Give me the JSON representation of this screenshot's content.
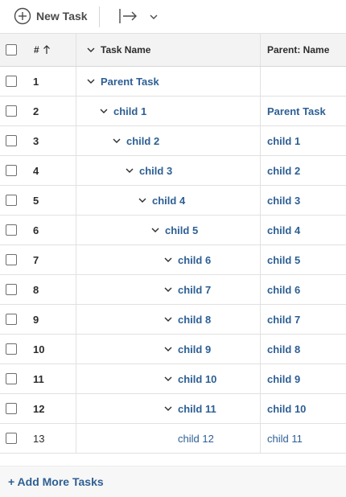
{
  "toolbar": {
    "new_task_label": "New Task",
    "icons": [
      "plus-circle-icon",
      "export-icon",
      "chevron-down-icon"
    ]
  },
  "columns": {
    "number": "#",
    "task_name": "Task Name",
    "parent_name": "Parent: Name"
  },
  "rows": [
    {
      "number": "1",
      "name": "Parent Task",
      "parent": "",
      "depth": 0,
      "collapsible": true
    },
    {
      "number": "2",
      "name": "child 1",
      "parent": "Parent Task",
      "depth": 1,
      "collapsible": true
    },
    {
      "number": "3",
      "name": "child 2",
      "parent": "child 1",
      "depth": 2,
      "collapsible": true
    },
    {
      "number": "4",
      "name": "child 3",
      "parent": "child 2",
      "depth": 3,
      "collapsible": true
    },
    {
      "number": "5",
      "name": "child 4",
      "parent": "child 3",
      "depth": 4,
      "collapsible": true
    },
    {
      "number": "6",
      "name": "child 5",
      "parent": "child 4",
      "depth": 5,
      "collapsible": true
    },
    {
      "number": "7",
      "name": "child 6",
      "parent": "child 5",
      "depth": 6,
      "collapsible": true
    },
    {
      "number": "8",
      "name": "child 7",
      "parent": "child 6",
      "depth": 6,
      "collapsible": true
    },
    {
      "number": "9",
      "name": "child 8",
      "parent": "child 7",
      "depth": 6,
      "collapsible": true
    },
    {
      "number": "10",
      "name": "child 9",
      "parent": "child 8",
      "depth": 6,
      "collapsible": true
    },
    {
      "number": "11",
      "name": "child 10",
      "parent": "child 9",
      "depth": 6,
      "collapsible": true
    },
    {
      "number": "12",
      "name": "child 11",
      "parent": "child 10",
      "depth": 6,
      "collapsible": true
    },
    {
      "number": "13",
      "name": "child 12",
      "parent": "child 11",
      "depth": 6,
      "collapsible": false
    }
  ],
  "footer": {
    "add_more_label": "+ Add More Tasks"
  },
  "colors": {
    "link": "#2d5f94",
    "header_bg": "#f3f3f3",
    "grid_line": "#e1e1e1"
  }
}
